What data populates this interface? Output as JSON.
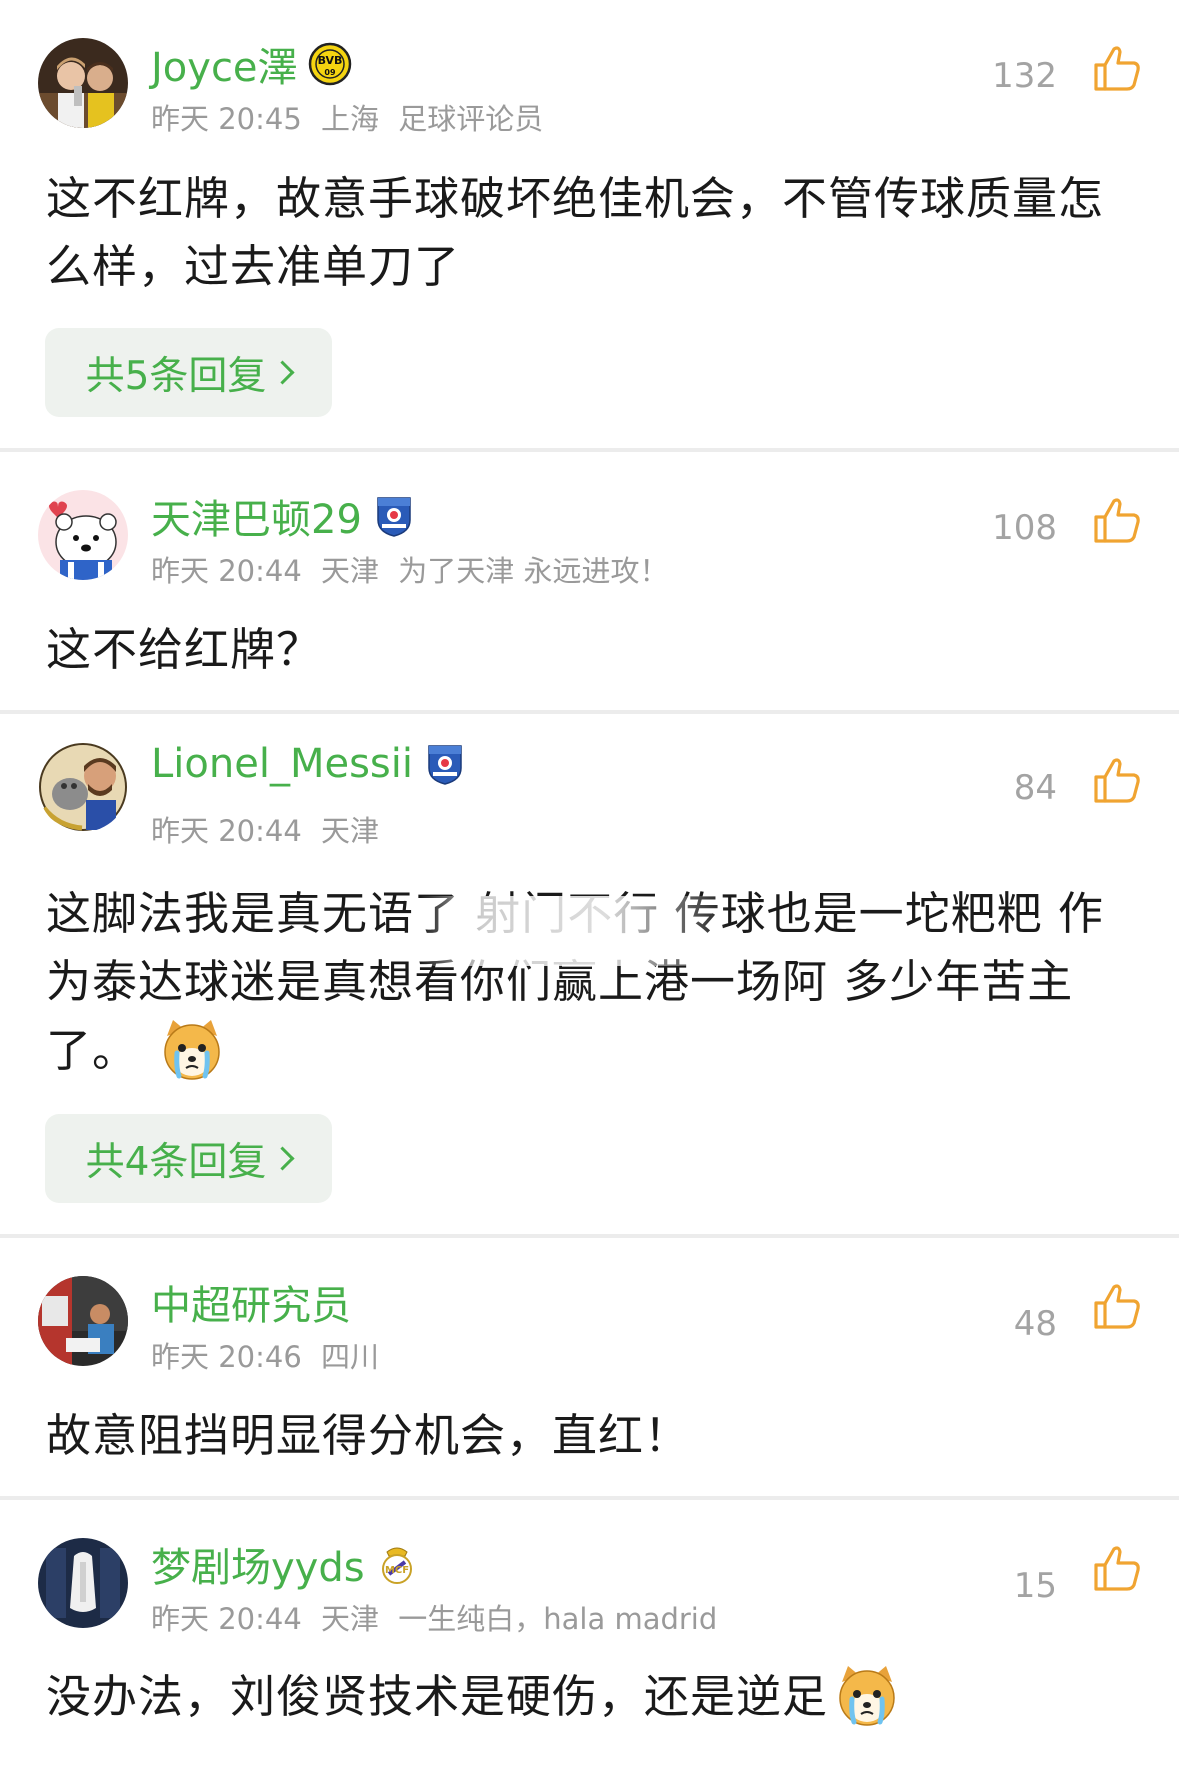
{
  "colors": {
    "username_green": "#47b04b",
    "meta_gray": "#9a9a9a",
    "like_orange": "#f0a431",
    "body_text": "#1a1a1a",
    "reply_bg": "#eef2ee"
  },
  "comments": [
    {
      "username": "Joyce澤",
      "badge_icon": "bvb-badge-icon",
      "time": "昨天 20:45",
      "location": "上海",
      "tag": "足球评论员",
      "likes": "132",
      "text": "这不红牌，故意手球破坏绝佳机会，不管传球质量怎么样，过去准单刀了",
      "replies": "共5条回复"
    },
    {
      "username": "天津巴顿29",
      "badge_icon": "tianjin-club-badge-icon",
      "time": "昨天 20:44",
      "location": "天津",
      "tag": "为了天津 永远进攻！",
      "likes": "108",
      "text": "这不给红牌？"
    },
    {
      "username": "Lionel_Messii",
      "badge_icon": "tianjin-club-badge-icon",
      "time": "昨天 20:44",
      "location": "天津",
      "likes": "84",
      "text_line1": "这脚法我是真无语了 射门不行 传球也是一坨粑粑 作",
      "text_line2": "为泰达球迷是真想看你们赢上港一场阿 多少年苦主",
      "text_line3": "了。",
      "emoji": "crying-dog-emoji",
      "replies": "共4条回复"
    },
    {
      "username": "中超研究员",
      "time": "昨天 20:46",
      "location": "四川",
      "likes": "48",
      "text": "故意阻挡明显得分机会，直红！"
    },
    {
      "username": "梦剧场yyds",
      "badge_icon": "real-madrid-badge-icon",
      "time": "昨天 20:44",
      "location": "天津",
      "tag": "一生纯白，hala madrid",
      "likes": "15",
      "text": "没办法，刘俊贤技术是硬伤，还是逆足",
      "emoji": "crying-dog-emoji"
    }
  ]
}
